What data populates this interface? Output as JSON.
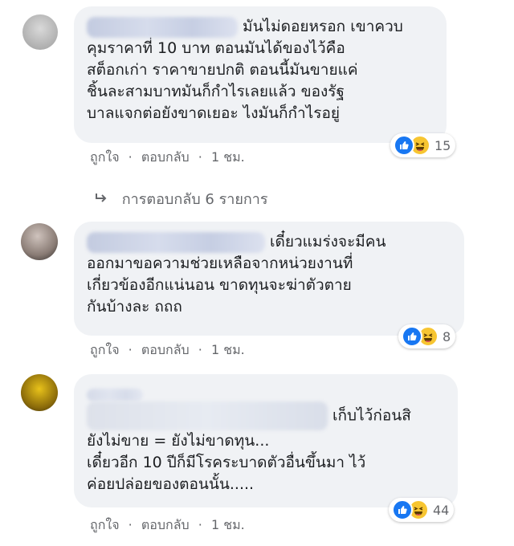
{
  "comments": [
    {
      "text_lines": [
        "มันไม่ดอยหรอก เขาควบ",
        "คุมราคาที่ 10 บาท ตอนมันได้ของไว้คือ",
        "สต็อกเก่า ราคาขายปกติ ตอนนี้มันขายแค่",
        "ชิ้นละสามบาทมันก็กำไรเลยแล้ว ของรัฐ",
        "บาลแจกต่อยังขาดเยอะ ไงมันก็กำไรอยู่"
      ],
      "like_label": "ถูกใจ",
      "reply_label": "ตอบกลับ",
      "time": "1 ชม.",
      "reaction_count": "15"
    },
    {
      "text_lines": [
        "เดี๋ยวแมร่งจะมีคน",
        "ออกมาขอความช่วยเหลือจากหน่วยงานที่",
        "เกี่ยวข้องอีกแน่นอน ขาดทุนจะฆ่าตัวตาย",
        "กันบ้างละ ถถถ"
      ],
      "like_label": "ถูกใจ",
      "reply_label": "ตอบกลับ",
      "time": "1 ชม.",
      "reaction_count": "8"
    },
    {
      "text_lines": [
        "เก็บไว้ก่อนสิ",
        "ยังไม่ขาย = ยังไม่ขาดทุน...",
        "เดี๋ยวอีก 10 ปีก็มีโรคระบาดตัวอื่นขึ้นมา ไว้",
        "ค่อยปล่อยของตอนนั้น....."
      ],
      "like_label": "ถูกใจ",
      "reply_label": "ตอบกลับ",
      "time": "1 ชม.",
      "reaction_count": "44"
    }
  ],
  "replies_link": "การตอบกลับ 6 รายการ",
  "separator": "·",
  "colors": {
    "bubble": "#f0f2f5",
    "meta_text": "#65676b",
    "like_blue": "#1877f2",
    "haha_yellow": "#f7c531"
  }
}
